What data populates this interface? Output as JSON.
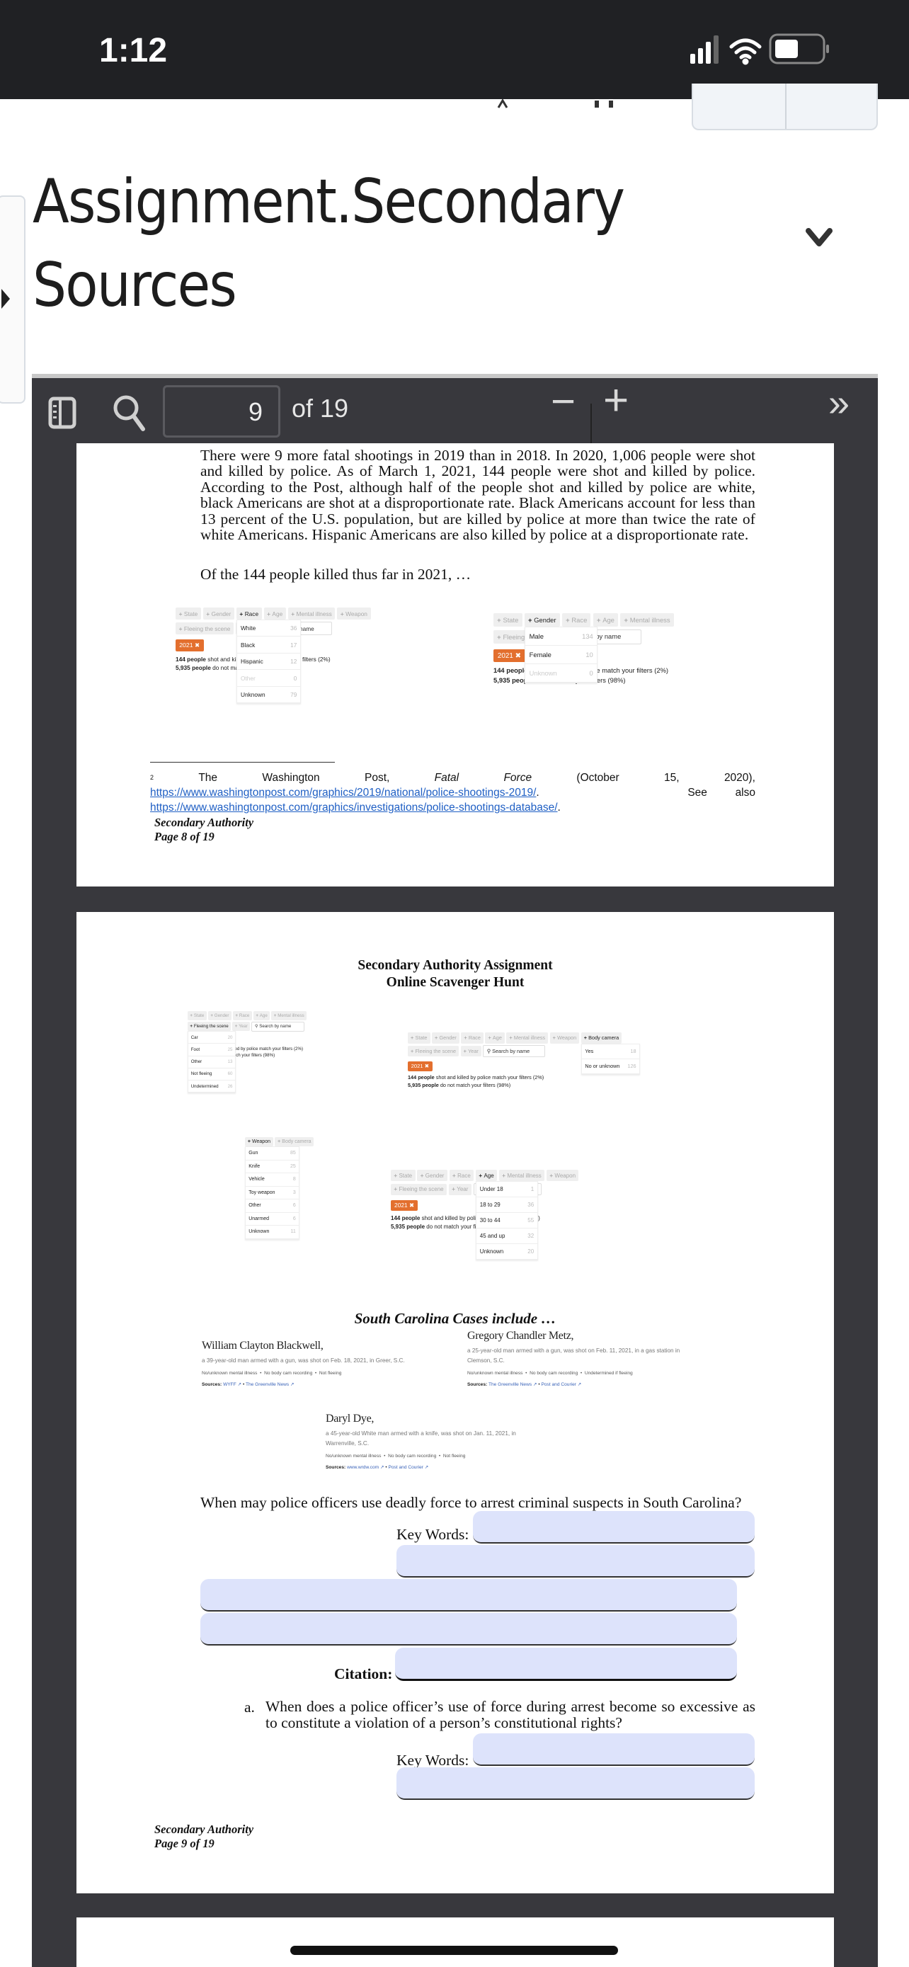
{
  "status_bar": {
    "time": "1:12",
    "icons": [
      "cellular-signal-icon",
      "wifi-icon",
      "battery-icon"
    ]
  },
  "header": {
    "title": "Assignment.Secondary Sources",
    "chevron": "chevron-down-icon"
  },
  "toolbar": {
    "page_number": "9",
    "page_total": "of 19",
    "zoom_out": "−",
    "zoom_in": "+",
    "more": "»"
  },
  "page8": {
    "paragraph_parts": [
      "There were 9 more fatal shootings in 2019 than in 2018.  In 2020, 1,006 people were shot and killed by police.  As of March 1, 2021, 144 people were shot and killed by police.  According to the Post, although half of the people shot and killed by police are white, black Americans are shot at a disproportionate rate. Black Americans ",
      "account for less than 13 percent of the U.S. population, but are killed by police at more than twice the rate of white Americans. Hispanic Americans are also killed by police at a disproportionate rate."
    ],
    "lead": "Of the 144 people killed thus far in 2021,  …",
    "footnote": {
      "marker": "2",
      "text_parts": [
        "The",
        "Washington",
        "Post,",
        "Fatal",
        "Force",
        "(October",
        "15,",
        "2020),"
      ],
      "link1": "https://www.washingtonpost.com/graphics/2019/national/police-shootings-2019/",
      "see_also": "See",
      "also": "also",
      "link2": "https://www.washingtonpost.com/graphics/investigations/police-shootings-database/"
    },
    "footer": {
      "line1": "Secondary Authority",
      "line2": "Page 8 of 19"
    }
  },
  "summary": {
    "bold1": "144 people",
    "rest1": " shot and killed by police match your filters (2%)",
    "bold2": "5,935 people",
    "rest2": " do not match your filters (98%)",
    "year_tag": "2021 ✖",
    "search": "Search by name"
  },
  "widgets": [
    {
      "id": "w1",
      "row1": [
        "State",
        "Gender",
        "Race",
        "Age",
        "Mental illness",
        "Weapon"
      ],
      "row2": [
        "Fleeing the scene",
        "Year"
      ],
      "search": true,
      "active": "Race",
      "tag": true,
      "summary": true,
      "dropdown": [
        {
          "label": "White",
          "count": "36"
        },
        {
          "label": "Black",
          "count": "17"
        },
        {
          "label": "Hispanic",
          "count": "12"
        },
        {
          "label": "Other",
          "count": "0",
          "dim": true
        },
        {
          "label": "Unknown",
          "count": "79"
        }
      ]
    },
    {
      "id": "w2",
      "row1": [
        "State",
        "Gender",
        "Race",
        "Age",
        "Mental illness"
      ],
      "row2": [
        "Fleeing the scene"
      ],
      "search": true,
      "active": "Gender",
      "tag": true,
      "summary": true,
      "dropdown": [
        {
          "label": "Male",
          "count": "134"
        },
        {
          "label": "Female",
          "count": "10"
        },
        {
          "label": "Unknown",
          "count": "0",
          "dim": true
        }
      ]
    },
    {
      "id": "wa",
      "row1": [
        "State",
        "Gender",
        "Race",
        "Age",
        "Mental illness"
      ],
      "row2": [
        "Fleeing the scene",
        "Year"
      ],
      "search": true,
      "active": "Fleeing the scene",
      "tag": true,
      "summary": true,
      "dropdown": [
        {
          "label": "Car",
          "count": "20"
        },
        {
          "label": "Foot",
          "count": "25"
        },
        {
          "label": "Other",
          "count": "13"
        },
        {
          "label": "Not fleeing",
          "count": "60"
        },
        {
          "label": "Undetermined",
          "count": "26"
        }
      ]
    },
    {
      "id": "wb",
      "row1": [
        "State",
        "Gender",
        "Race",
        "Age",
        "Mental illness",
        "Weapon",
        "Body camera"
      ],
      "row2": [
        "Fleeing the scene",
        "Year"
      ],
      "search": true,
      "active": "Body camera",
      "tag": true,
      "summary": true,
      "dropdown": [
        {
          "label": "Yes",
          "count": "18"
        },
        {
          "label": "No or unknown",
          "count": "126"
        }
      ]
    },
    {
      "id": "wc",
      "row1": [
        "Weapon",
        "Body camera"
      ],
      "row2": [],
      "search": false,
      "active": "Weapon",
      "tag": false,
      "summary": false,
      "dropdown": [
        {
          "label": "Gun",
          "count": "85"
        },
        {
          "label": "Knife",
          "count": "25"
        },
        {
          "label": "Vehicle",
          "count": "8"
        },
        {
          "label": "Toy weapon",
          "count": "3"
        },
        {
          "label": "Other",
          "count": "6"
        },
        {
          "label": "Unarmed",
          "count": "6"
        },
        {
          "label": "Unknown",
          "count": "11"
        }
      ]
    },
    {
      "id": "wd",
      "row1": [
        "State",
        "Gender",
        "Race",
        "Age",
        "Mental illness",
        "Weapon"
      ],
      "row2": [
        "Fleeing the scene",
        "Year"
      ],
      "search": true,
      "active": "Age",
      "tag": true,
      "summary": true,
      "dropdown": [
        {
          "label": "Under 18",
          "count": "1"
        },
        {
          "label": "18 to 29",
          "count": "36"
        },
        {
          "label": "30 to 44",
          "count": "55"
        },
        {
          "label": "45 and up",
          "count": "32"
        },
        {
          "label": "Unknown",
          "count": "20"
        }
      ]
    }
  ],
  "page9": {
    "title1": "Secondary Authority Assignment",
    "title2": "Online Scavenger Hunt",
    "cases_heading": "South Carolina Cases include …",
    "cases": [
      {
        "name": "William Clayton Blackwell,",
        "desc": "a 39-year-old man armed with a gun, was shot on Feb. 18, 2021, in Greer, S.C.",
        "tags": "No/unknown mental illness  •  No body cam recording  •  Not fleeing",
        "sources_label": "Sources:",
        "sources": [
          "WYFF ↗",
          "The Greenville News ↗"
        ]
      },
      {
        "name": "Gregory Chandler Metz,",
        "desc": "a 25-year-old man armed with a gun, was shot on Feb. 11, 2021, in a gas station in Clemson, S.C.",
        "tags": "No/unknown mental illness  •  No body cam recording  •  Undetermined if fleeing",
        "sources_label": "Sources:",
        "sources": [
          "The Greenville News ↗",
          "Post and Courier ↗"
        ]
      },
      {
        "name": "Daryl Dye,",
        "desc": "a 45-year-old White man armed with a knife, was shot on Jan. 11, 2021, in Warrenville, S.C.",
        "tags": "No/unknown mental illness  •  No body cam recording  •  Not fleeing",
        "sources_label": "Sources:",
        "sources": [
          "www.wrdw.com ↗",
          "Post and Courier ↗"
        ]
      }
    ],
    "question1": "When may police officers use deadly force to arrest criminal suspects in South Carolina?",
    "key_words_label": "Key Words:",
    "citation_label": "Citation:",
    "question_a_marker": "a.",
    "question_a": "When does a police officer’s use of force during arrest become so excessive as to constitute a violation of a person’s constitutional rights?",
    "footer": {
      "line1": "Secondary Authority",
      "line2": "Page 9 of 19"
    }
  },
  "colors": {
    "form_field": "#dde3fb",
    "year_tag": "#e36f2e",
    "viewer_bg": "#38383d",
    "link": "#1f5fc4"
  }
}
